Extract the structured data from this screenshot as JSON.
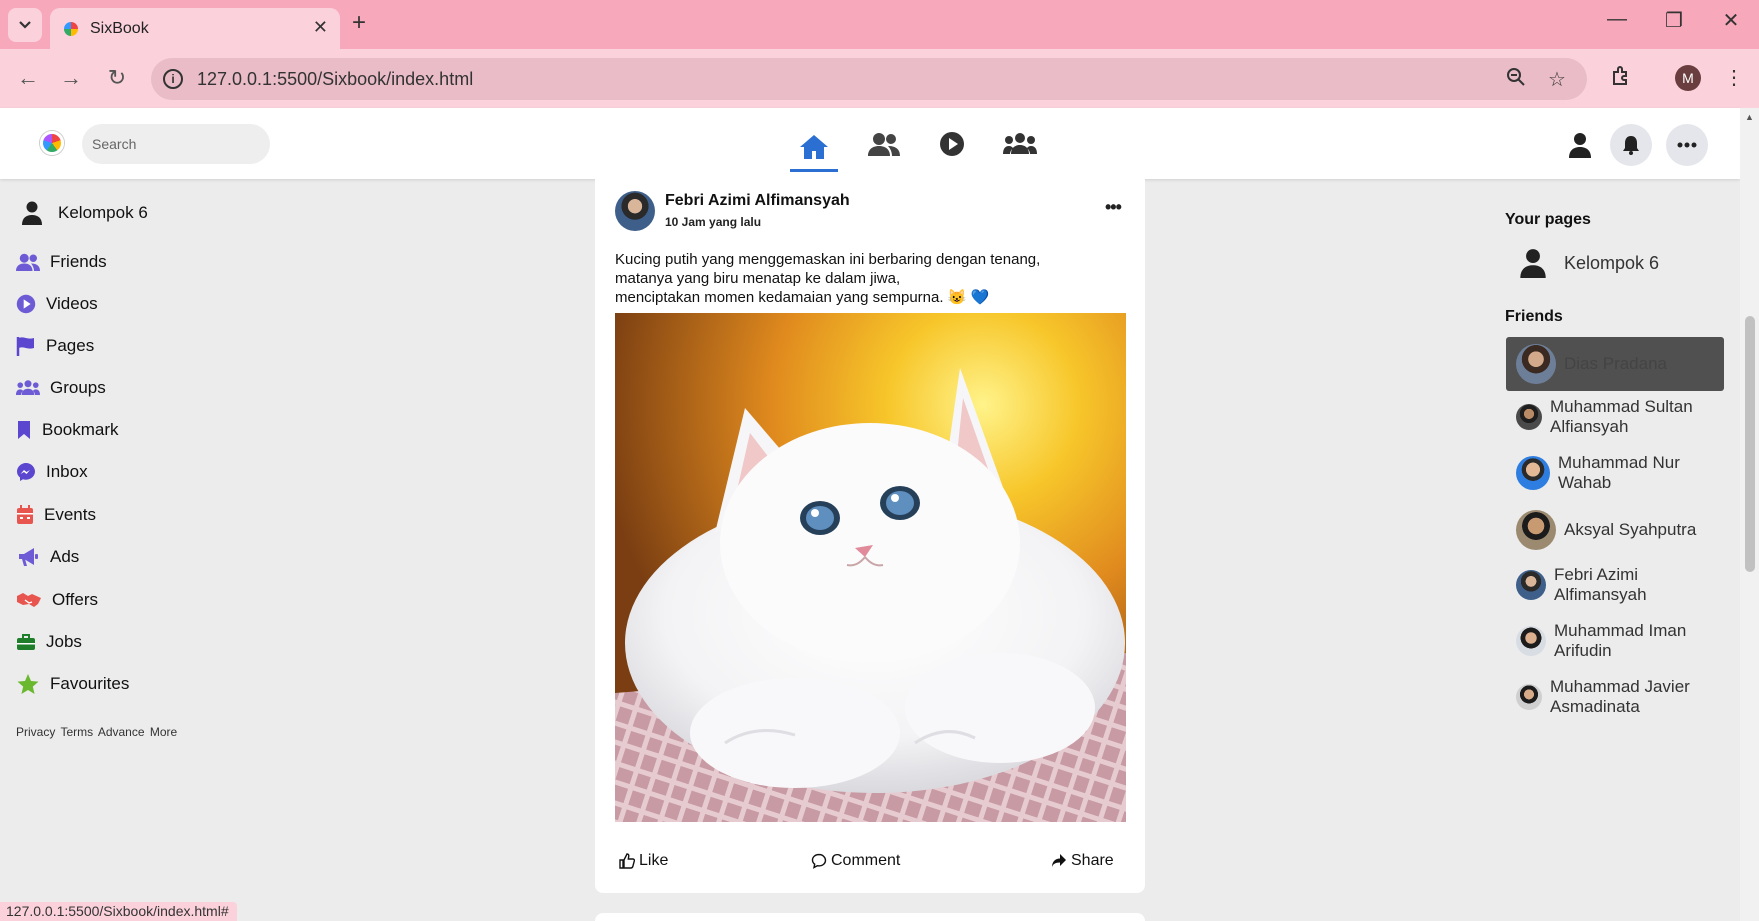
{
  "browser": {
    "tab_title": "SixBook",
    "url": "127.0.0.1:5500/Sixbook/index.html",
    "profile_initial": "M",
    "status_url": "127.0.0.1:5500/Sixbook/index.html#",
    "accent": "#f8a8bb"
  },
  "header": {
    "search_placeholder": "Search",
    "nav_icons": [
      "home-icon",
      "friends-icon",
      "watch-icon",
      "groups-icon"
    ],
    "right_icons": [
      "user-icon",
      "bell-icon",
      "more-icon"
    ],
    "active_color": "#2a6fd1"
  },
  "left_sidebar": {
    "profile_name": "Kelompok 6",
    "items": [
      {
        "label": "Friends",
        "icon": "friends-icon",
        "color": "#6d5bd6"
      },
      {
        "label": "Videos",
        "icon": "video-icon",
        "color": "#6d5bd6"
      },
      {
        "label": "Pages",
        "icon": "flag-icon",
        "color": "#5b46cf"
      },
      {
        "label": "Groups",
        "icon": "groups-icon",
        "color": "#6d5bd6"
      },
      {
        "label": "Bookmark",
        "icon": "bookmark-icon",
        "color": "#5b46cf"
      },
      {
        "label": "Inbox",
        "icon": "messenger-icon",
        "color": "#5b46cf"
      },
      {
        "label": "Events",
        "icon": "calendar-icon",
        "color": "#e8554e"
      },
      {
        "label": "Ads",
        "icon": "megaphone-icon",
        "color": "#6d5bd6"
      },
      {
        "label": "Offers",
        "icon": "handshake-icon",
        "color": "#e8554e"
      },
      {
        "label": "Jobs",
        "icon": "briefcase-icon",
        "color": "#1e7e2a"
      },
      {
        "label": "Favourites",
        "icon": "star-icon",
        "color": "#6ab82d"
      }
    ],
    "footer": [
      "Privacy",
      "Terms",
      "Advance",
      "More"
    ]
  },
  "post": {
    "author": "Febri Azimi Alfimansyah",
    "time": "10 Jam yang lalu",
    "text_lines": [
      "Kucing putih yang menggemaskan ini berbaring dengan tenang,",
      "matanya yang biru menatap ke dalam jiwa,",
      "menciptakan momen kedamaian yang sempurna. 😺 💙"
    ],
    "actions": {
      "like": "Like",
      "comment": "Comment",
      "share": "Share"
    }
  },
  "right_sidebar": {
    "pages_heading": "Your pages",
    "page_name": "Kelompok 6",
    "friends_heading": "Friends",
    "friends": [
      {
        "name": "Dias Pradana",
        "highlighted": true
      },
      {
        "name": "Muhammad Sultan Alfiansyah",
        "highlighted": false
      },
      {
        "name": "Muhammad Nur Wahab",
        "highlighted": false
      },
      {
        "name": "Aksyal Syahputra",
        "highlighted": false
      },
      {
        "name": "Febri Azimi Alfimansyah",
        "highlighted": false
      },
      {
        "name": "Muhammad Iman Arifudin",
        "highlighted": false
      },
      {
        "name": "Muhammad Javier Asmadinata",
        "highlighted": false
      }
    ]
  }
}
